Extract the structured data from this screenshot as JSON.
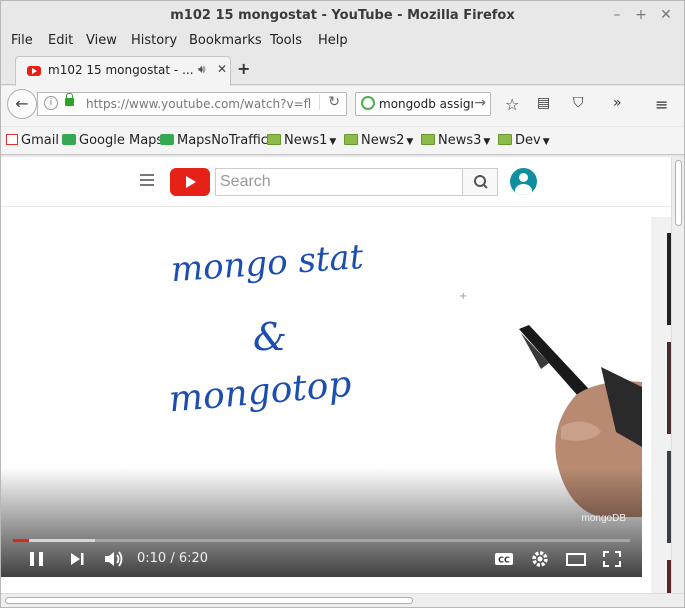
{
  "window": {
    "title": "m102 15 mongostat - YouTube - Mozilla Firefox"
  },
  "menu": {
    "file": "File",
    "edit": "Edit",
    "view": "View",
    "history": "History",
    "bookmarks": "Bookmarks",
    "tools": "Tools",
    "help": "Help"
  },
  "tab": {
    "label": "m102 15 mongostat - ..."
  },
  "navbar": {
    "url": "https://www.youtube.com/watch?v=fl",
    "search_value": "mongodb assign"
  },
  "bookmarks": [
    {
      "label": "Gmail"
    },
    {
      "label": "Google Maps"
    },
    {
      "label": "MapsNoTraffic"
    },
    {
      "label": "News1"
    },
    {
      "label": "News2"
    },
    {
      "label": "News3"
    },
    {
      "label": "Dev"
    }
  ],
  "youtube": {
    "search_placeholder": "Search"
  },
  "video": {
    "handwriting_line1": "mongo stat",
    "handwriting_line2": "&",
    "handwriting_line3": "mongotop",
    "watermark": "mongoDB",
    "time_display": "0:10 / 6:20",
    "played_fraction": 0.026,
    "cc_label": "CC"
  },
  "colors": {
    "brand_red": "#e62117",
    "ink_blue": "#1c4db0"
  }
}
